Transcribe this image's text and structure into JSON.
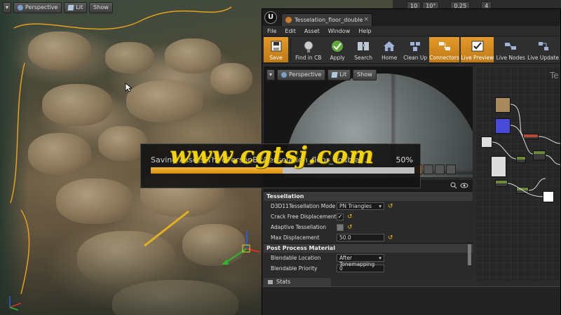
{
  "level_viewport": {
    "perspective_label": "Perspective",
    "lit_label": "Lit",
    "show_label": "Show"
  },
  "main_toolbar": {
    "values": [
      "10",
      "10°",
      "0.25",
      "4"
    ]
  },
  "material_editor": {
    "tab_title": "Tesselation_floor_double",
    "logo": "U",
    "menu": [
      "File",
      "Edit",
      "Asset",
      "Window",
      "Help"
    ],
    "toolbar": [
      {
        "label": "Save",
        "icon": "save-icon"
      },
      {
        "label": "Find in CB",
        "icon": "find-in-cb-icon"
      },
      {
        "label": "Apply",
        "icon": "apply-icon"
      },
      {
        "label": "Search",
        "icon": "search-icon"
      },
      {
        "label": "Home",
        "icon": "home-icon"
      },
      {
        "label": "Clean Up",
        "icon": "clean-up-icon"
      },
      {
        "label": "Connectors",
        "icon": "connectors-icon"
      },
      {
        "label": "Live Preview",
        "icon": "live-preview-icon"
      },
      {
        "label": "Live Nodes",
        "icon": "live-nodes-icon"
      },
      {
        "label": "Live Update",
        "icon": "live-update-icon"
      }
    ],
    "preview": {
      "perspective_label": "Perspective",
      "lit_label": "Lit",
      "show_label": "Show"
    },
    "graph_title": "Te",
    "details": {
      "tessellation_header": "Tessellation",
      "rows": [
        {
          "label": "D3D11Tessellation Mode",
          "type": "dropdown",
          "value": "PN Triangles"
        },
        {
          "label": "Crack Free Displacement",
          "type": "checkbox",
          "checked": true
        },
        {
          "label": "Adaptive Tessellation",
          "type": "checkbox",
          "checked": false
        },
        {
          "label": "Max Displacement",
          "type": "number",
          "value": "50.0"
        }
      ],
      "post_process_header": "Post Process Material",
      "pp_rows": [
        {
          "label": "Blendable Location",
          "type": "dropdown",
          "value": "After Tonemapping"
        },
        {
          "label": "Blendable Priority",
          "type": "number",
          "value": "0"
        }
      ]
    },
    "stats_tab": "Stats"
  },
  "progress_dialog": {
    "text": "Saving Assets/ThirdPersonBP/Tesselation_floor_double...",
    "percent_label": "50%",
    "percent": 50
  },
  "watermark": "www.cgtsj.com",
  "colors": {
    "accent": "#e39a2a",
    "progress_fill": "#d9900f",
    "watermark": "#f2d20c"
  }
}
